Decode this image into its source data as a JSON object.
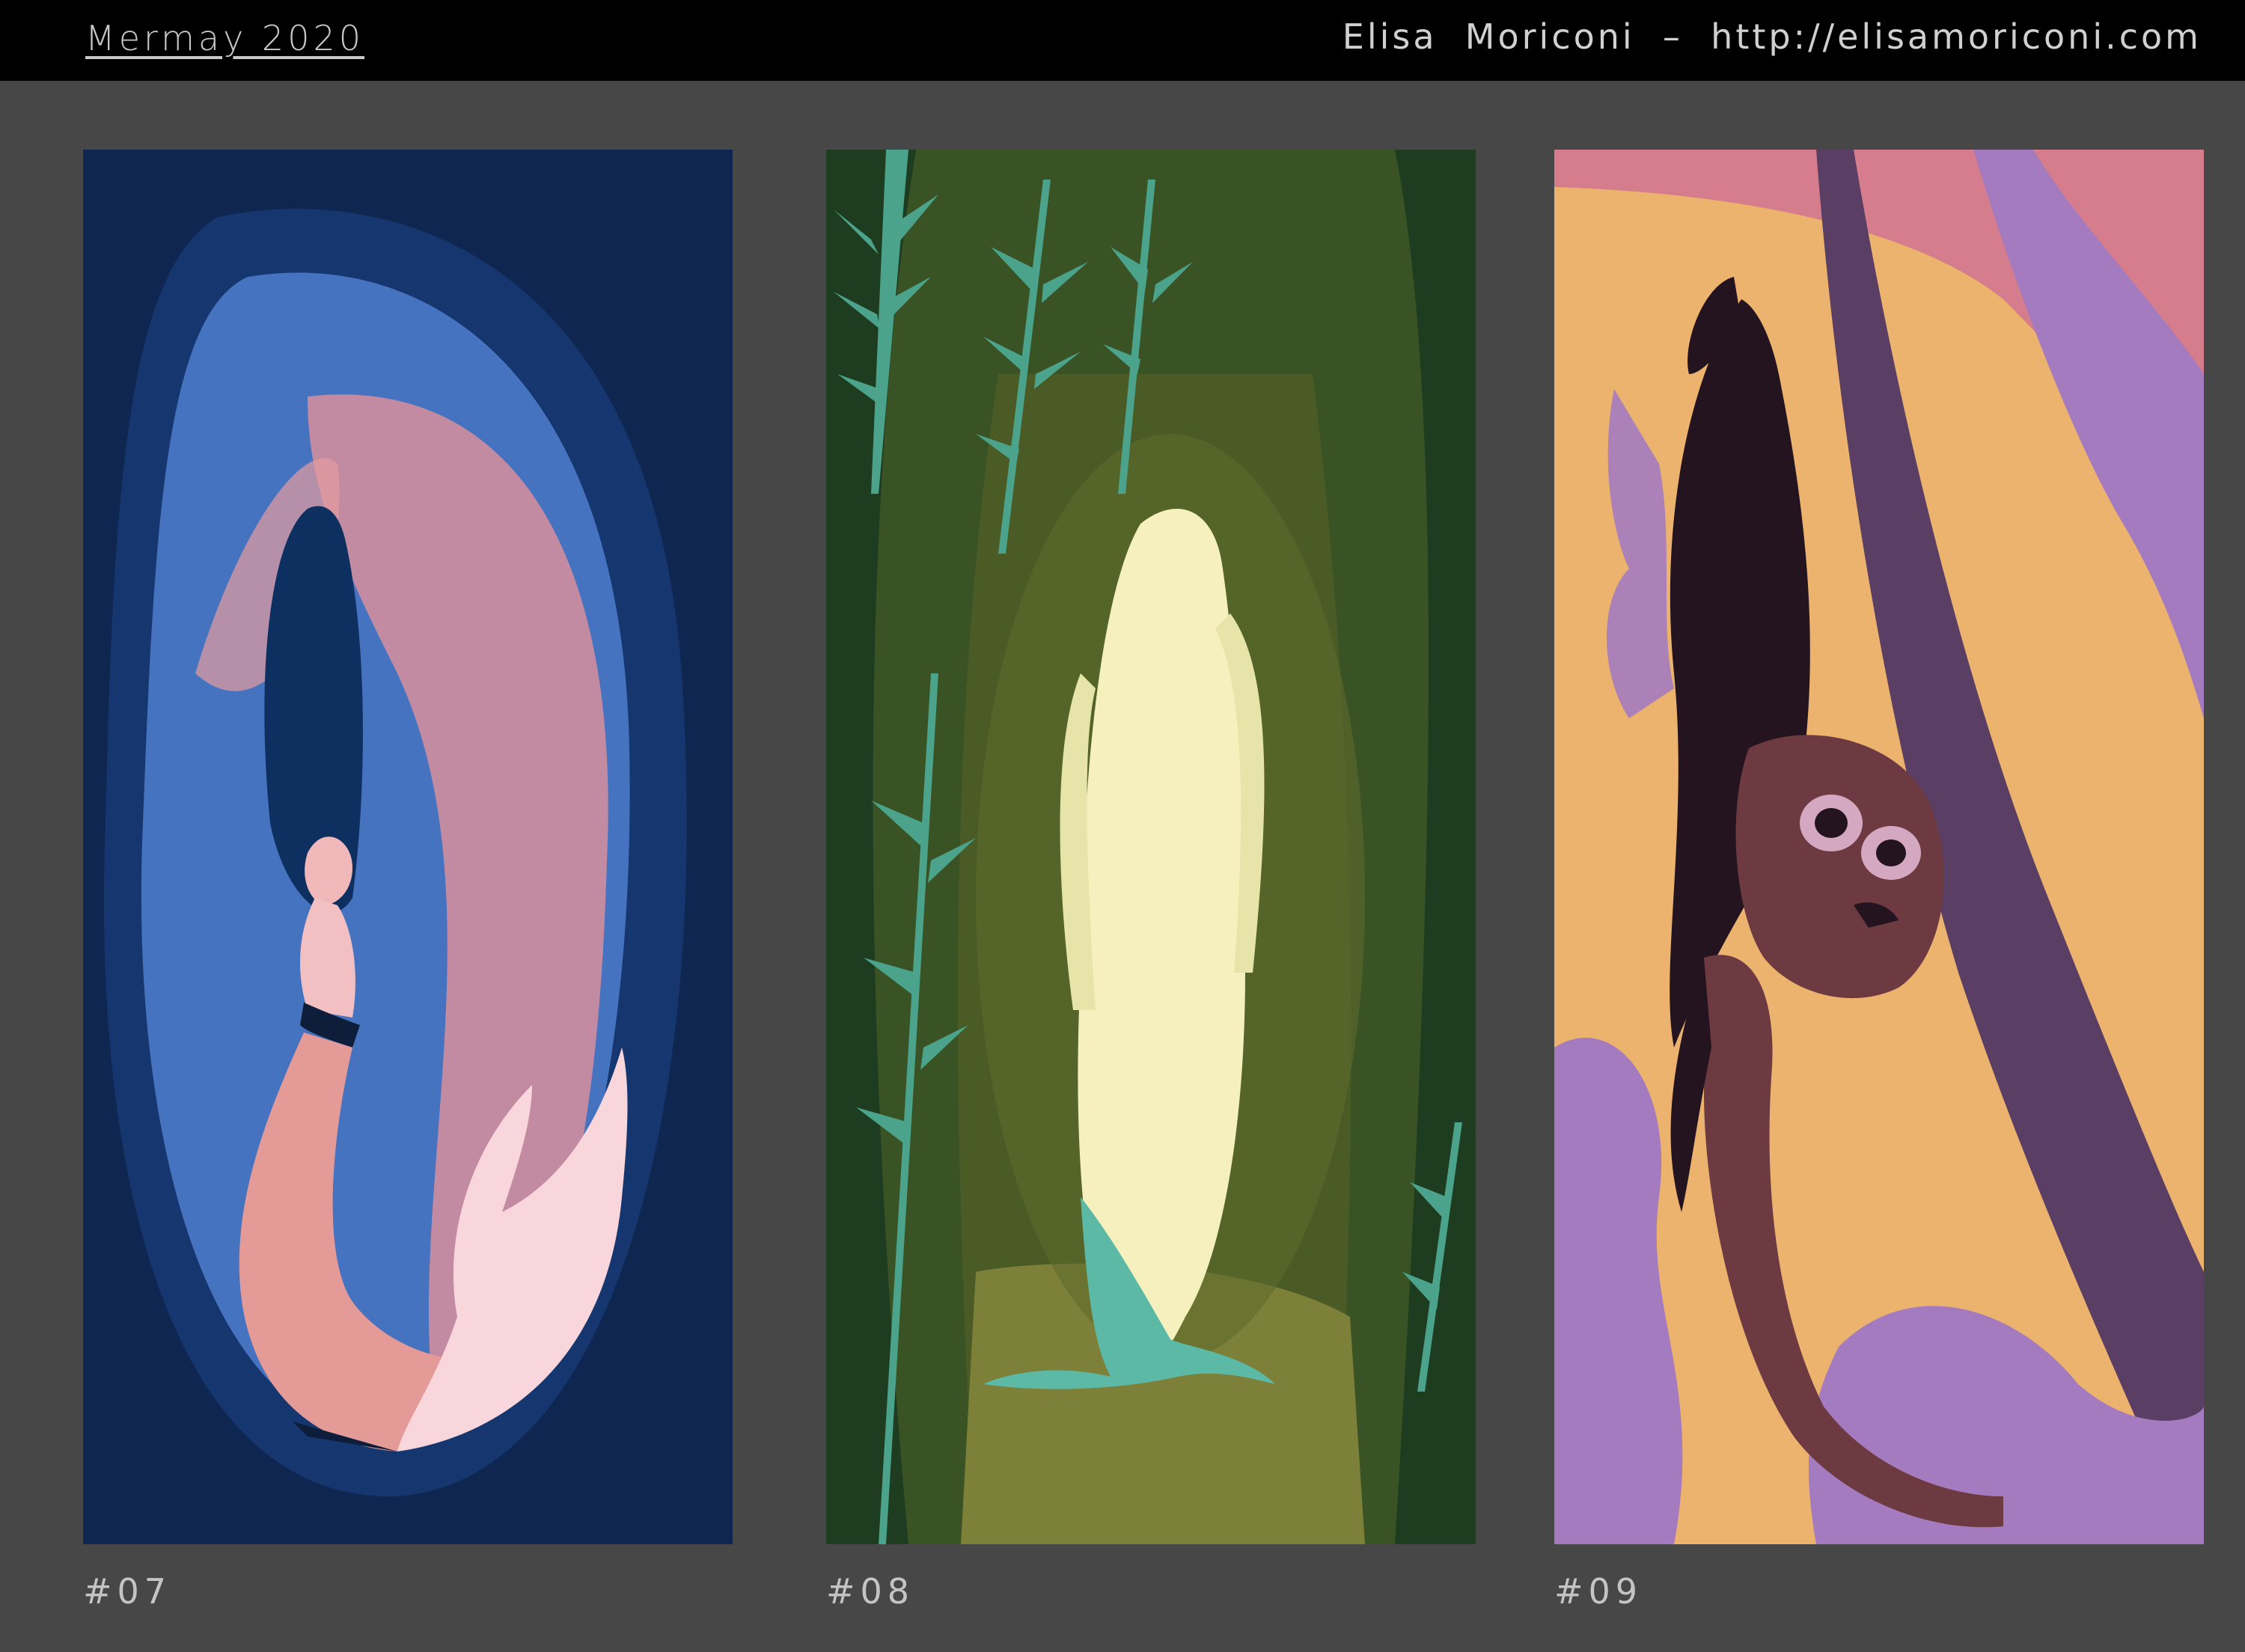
{
  "header": {
    "title": "Mermay 2020",
    "credit": "Elisa  Moriconi  –  http://elisamoriconi.com"
  },
  "gallery": {
    "items": [
      {
        "caption": "#07",
        "palette": {
          "bg": "#0f2650",
          "cave": "#15366e",
          "light": "#4673c0",
          "glow": "#e59ca0",
          "tail": "#f4c5cc",
          "hair": "#0e3060"
        }
      },
      {
        "caption": "#08",
        "palette": {
          "bg": "#1e3d20",
          "mid": "#4a5b25",
          "path": "#7d8038",
          "figure": "#f5f0be",
          "tail": "#5cb9a6",
          "leaf": "#4aa38a"
        }
      },
      {
        "caption": "#09",
        "palette": {
          "bg": "#ecb36e",
          "pink": "#d57c8d",
          "purple": "#a47bbf",
          "plum": "#5a3e64",
          "hair": "#24141f",
          "skin": "#6e3a42"
        }
      }
    ]
  }
}
